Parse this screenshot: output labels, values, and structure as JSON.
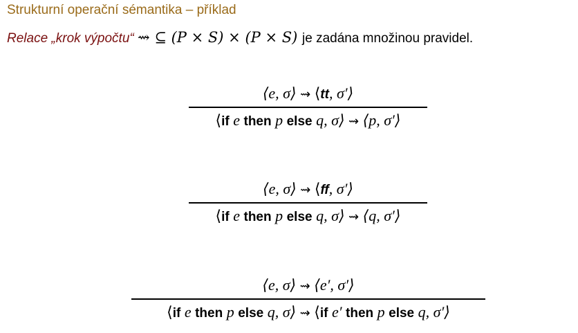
{
  "slide": {
    "title": "Strukturní operační sémantika – příklad",
    "intro": {
      "relation_label": "Relace „krok výpočtu“",
      "arrow": "⇝",
      "subset": "⊆",
      "domain_left": "(P × S)",
      "times": "×",
      "domain_right": "(P × S)",
      "suffix": "je zadána množinou pravidel."
    }
  },
  "rules": [
    {
      "premise": {
        "lhs": "⟨e, σ⟩",
        "arrow": "⇝",
        "rhs_open": "⟨",
        "rhs_kw": "tt",
        "rhs_rest": ", σ′⟩"
      },
      "conclusion": {
        "kw_if": "if",
        "e": "e",
        "kw_then": "then",
        "p": "p",
        "kw_else": "else",
        "q": "q, σ⟩",
        "open": "⟨",
        "arrow": "⇝",
        "rhs": "⟨p, σ′⟩"
      }
    },
    {
      "premise": {
        "lhs": "⟨e, σ⟩",
        "arrow": "⇝",
        "rhs_open": "⟨",
        "rhs_kw": "ff",
        "rhs_rest": ", σ′⟩"
      },
      "conclusion": {
        "kw_if": "if",
        "e": "e",
        "kw_then": "then",
        "p": "p",
        "kw_else": "else",
        "q": "q, σ⟩",
        "open": "⟨",
        "arrow": "⇝",
        "rhs": "⟨q, σ′⟩"
      }
    },
    {
      "premise": {
        "lhs": "⟨e, σ⟩",
        "arrow": "⇝",
        "rhs": "⟨e′, σ′⟩"
      },
      "conclusion": {
        "kw_if": "if",
        "e": "e",
        "kw_then": "then",
        "p": "p",
        "kw_else": "else",
        "q": "q, σ⟩",
        "open": "⟨",
        "arrow": "⇝",
        "rhs_open": "⟨",
        "rhs_kw_if": "if",
        "rhs_e": "e′",
        "rhs_kw_then": "then",
        "rhs_p": "p",
        "rhs_kw_else": "else",
        "rhs_q": "q, σ′⟩"
      }
    }
  ]
}
